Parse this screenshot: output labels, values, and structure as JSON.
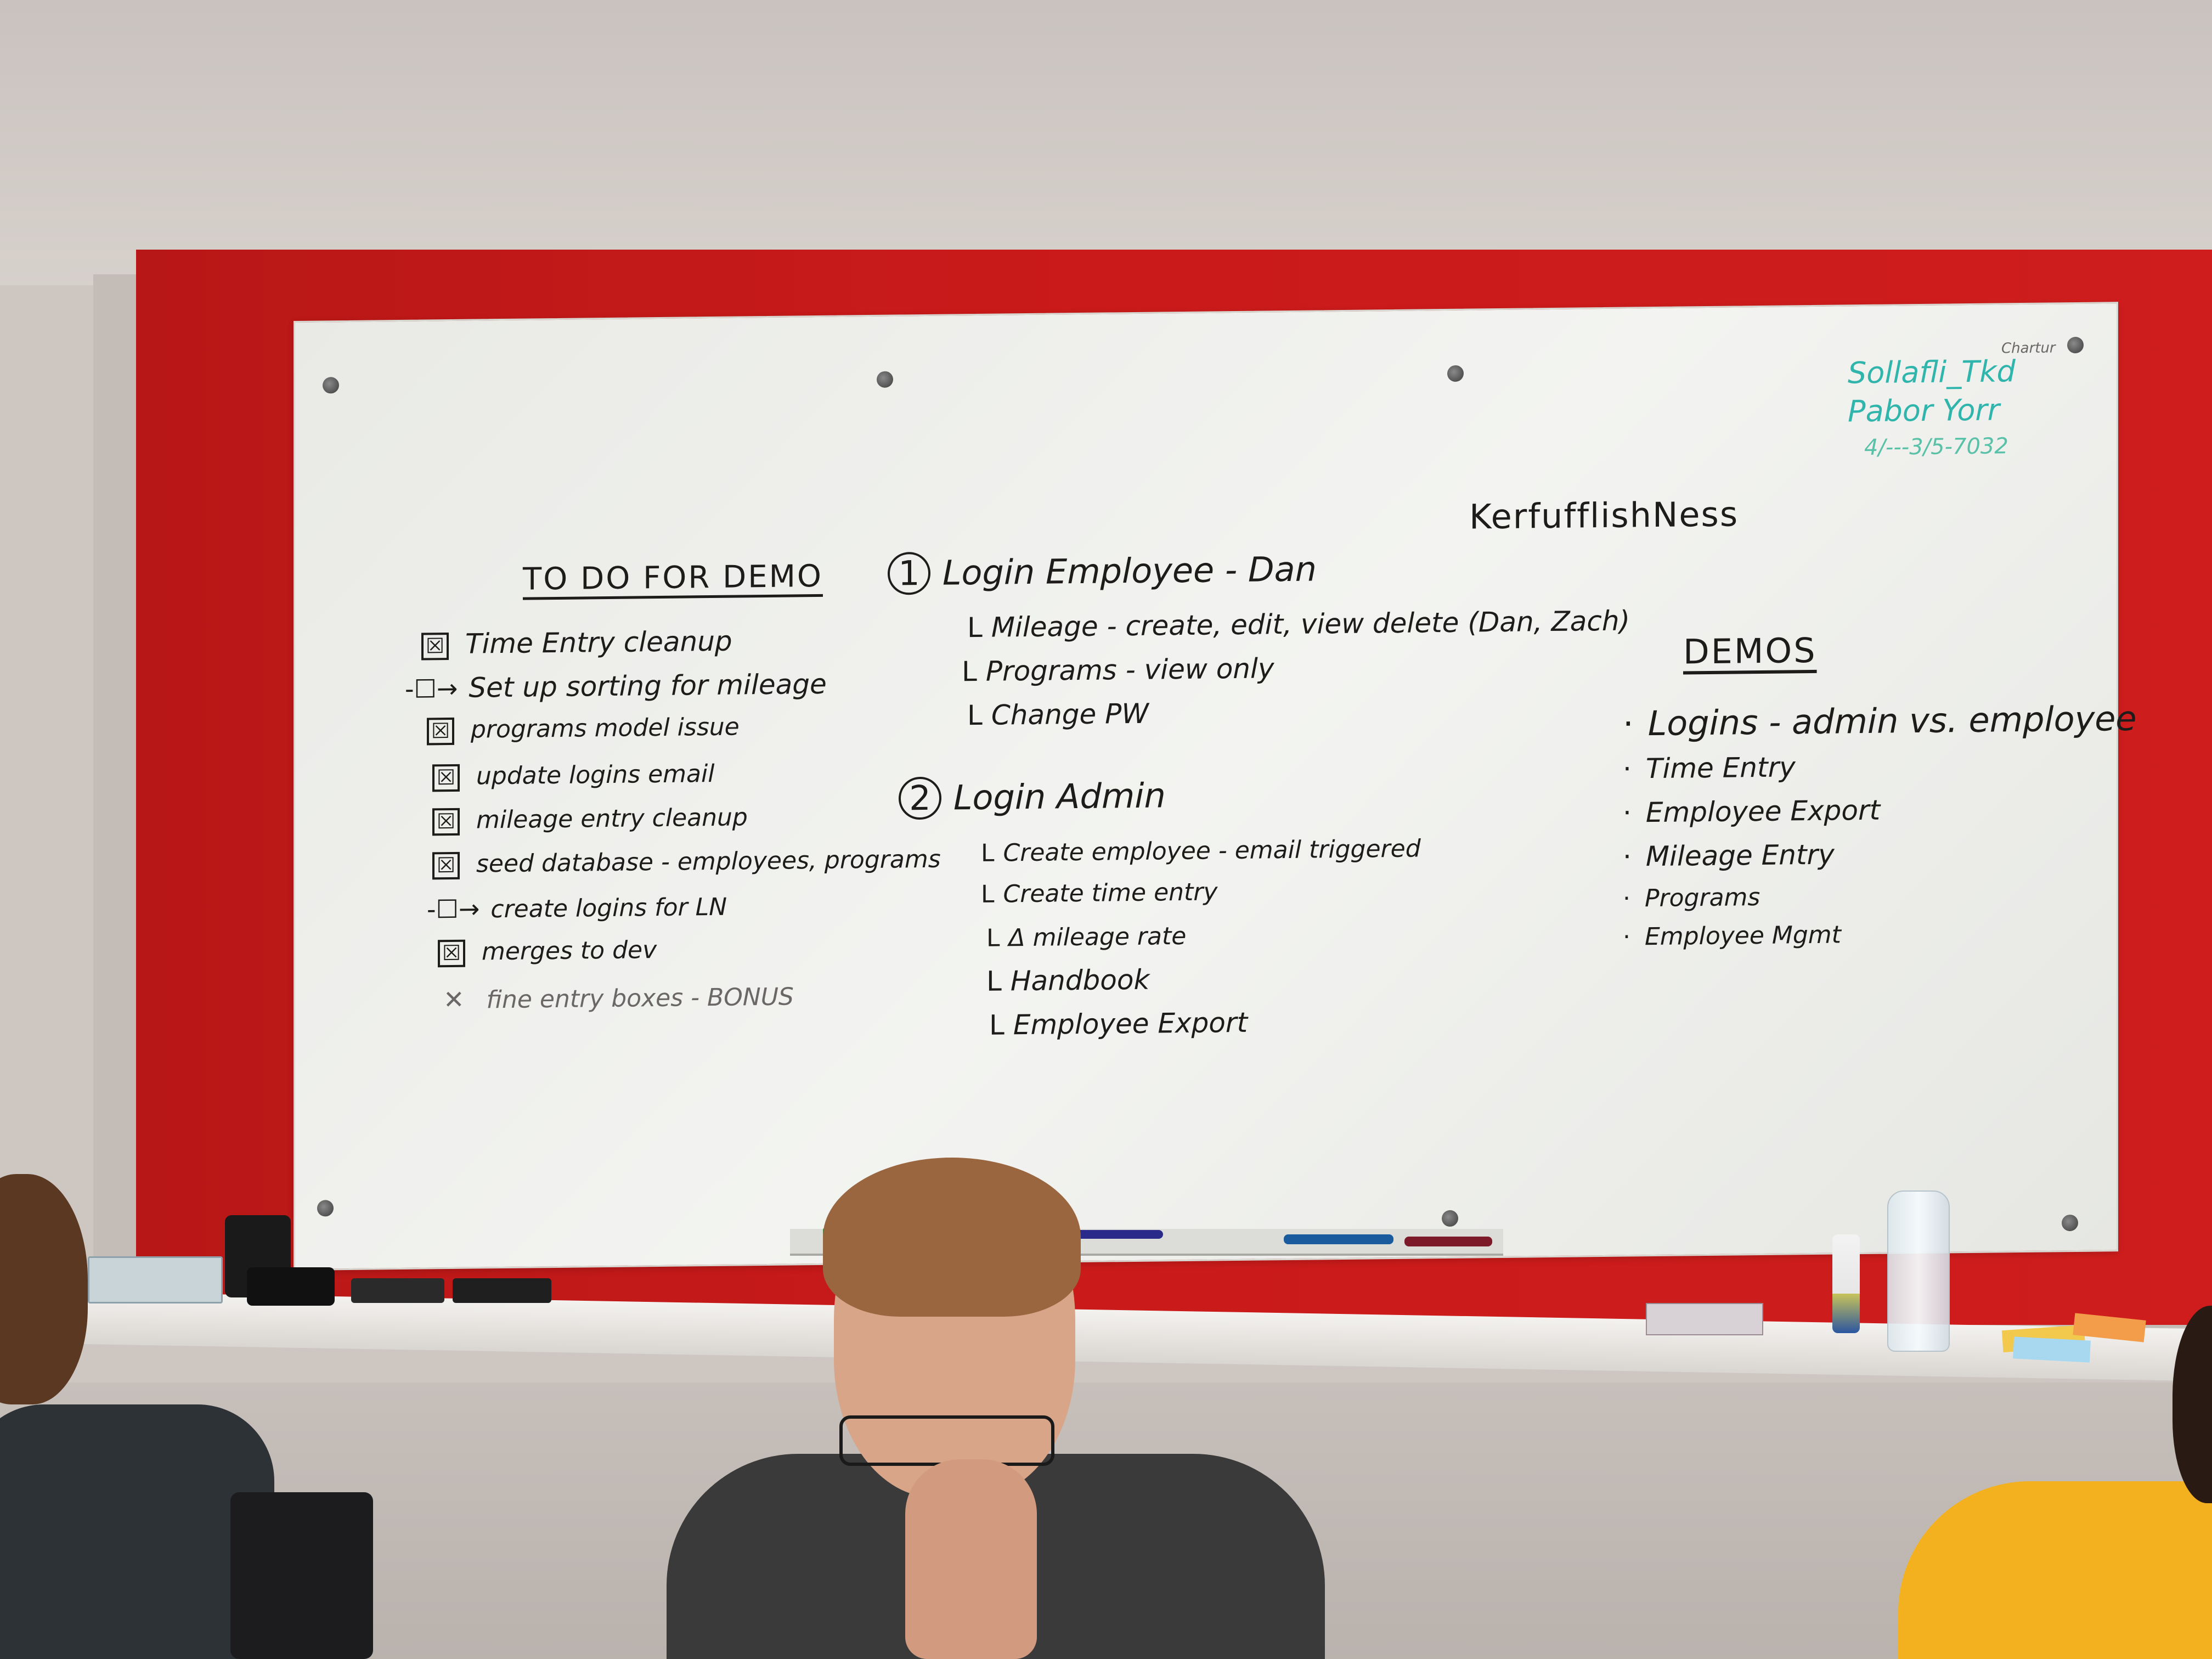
{
  "board": {
    "title": "KerfufflishNess",
    "contact": {
      "line1": "Sollafli_Tkd",
      "line2": "Pabor Yorr",
      "line3": "4/---3/5-7032",
      "tag": "Chartur"
    },
    "todo": {
      "heading": "TO DO FOR DEMO",
      "items": [
        {
          "mark": "☒",
          "text": "Time Entry cleanup"
        },
        {
          "mark": "-☐→",
          "text": "Set up sorting for mileage"
        },
        {
          "mark": "☒",
          "text": "programs model issue"
        },
        {
          "mark": "☒",
          "text": "update logins email"
        },
        {
          "mark": "☒",
          "text": "mileage entry cleanup"
        },
        {
          "mark": "☒",
          "text": "seed database - employees, programs"
        },
        {
          "mark": "-☐→",
          "text": "create logins for LN"
        },
        {
          "mark": "☒",
          "text": "merges to dev"
        },
        {
          "mark": "✕",
          "text": "fine entry boxes - BONUS"
        }
      ]
    },
    "flows": {
      "first": {
        "num": "1",
        "title": "Login Employee - Dan",
        "items": [
          "Mileage - create, edit, view delete (Dan, Zach)",
          "Programs - view only",
          "Change PW"
        ]
      },
      "second": {
        "num": "2",
        "title": "Login Admin",
        "items": [
          "Create employee - email triggered",
          "Create time entry",
          "Δ mileage rate",
          "Handbook",
          "Employee Export"
        ]
      }
    },
    "demos": {
      "heading": "DEMOS",
      "items": [
        "Logins - admin vs. employee",
        "Time Entry",
        "Employee Export",
        "Mileage Entry",
        "Programs",
        "Employee Mgmt"
      ]
    }
  },
  "colors": {
    "red_panel": "#c91a1a",
    "ink": "#1e1b1b",
    "teal_marker": "#2fb5ab"
  }
}
